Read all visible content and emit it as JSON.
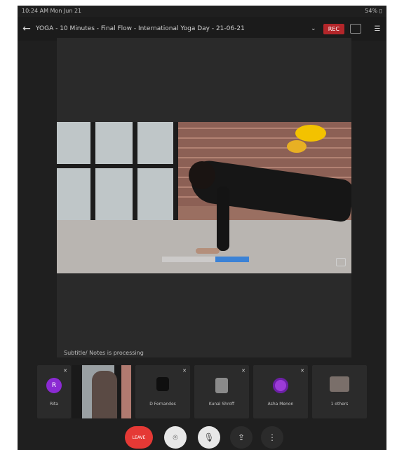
{
  "status": {
    "left": "10:24 AM  Mon Jun 21",
    "right": "54% ▯"
  },
  "topbar": {
    "back_icon": "←",
    "title": "YOGA - 10 Minutes - Final Flow - International Yoga Day - 21-06-21",
    "rec_label": "REC"
  },
  "main": {
    "notice": "Subtitle/ Notes is processing"
  },
  "strip": {
    "tiles": [
      {
        "initial": "R",
        "name": "Rita"
      },
      {
        "name": ""
      },
      {
        "name": "D Fernandes"
      },
      {
        "name": "Kunal Shroff"
      },
      {
        "name": "Asha Menon"
      },
      {
        "name": "1 others"
      }
    ]
  },
  "controls": {
    "end_label": "LEAVE",
    "cam_icon": "⌾",
    "mute_icon": "🎙",
    "share_icon": "⇪",
    "more_icon": "⋮"
  },
  "colors": {
    "record_red": "#b3262a",
    "end_red": "#e53935",
    "avatar_purple": "#8b2ad3",
    "progress_blue": "#3b82d6"
  }
}
